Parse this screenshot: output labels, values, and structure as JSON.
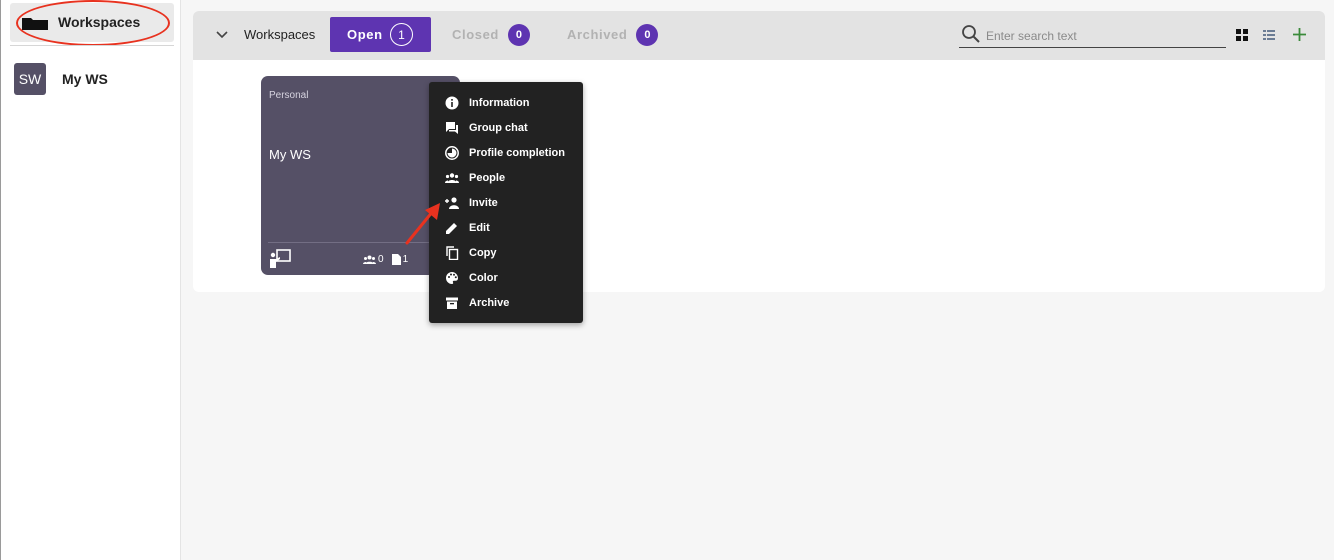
{
  "sidebar": {
    "header_title": "Workspaces",
    "items": [
      {
        "avatar": "SW",
        "label": "My WS"
      }
    ]
  },
  "toolbar": {
    "title": "Workspaces",
    "tabs": [
      {
        "label": "Open",
        "count": "1"
      },
      {
        "label": "Closed",
        "count": "0"
      },
      {
        "label": "Archived",
        "count": "0"
      }
    ],
    "search_placeholder": "Enter search text",
    "icons": [
      "chevron-down-icon",
      "search-icon",
      "grid-view-icon",
      "list-view-icon",
      "plus-icon"
    ]
  },
  "card": {
    "type": "Personal",
    "name": "My WS",
    "stats": {
      "people": "0",
      "documents": "1"
    }
  },
  "context_menu": {
    "items": [
      {
        "label": "Information",
        "icon": "info-icon"
      },
      {
        "label": "Group chat",
        "icon": "chat-icon"
      },
      {
        "label": "Profile completion",
        "icon": "pie-chart-icon"
      },
      {
        "label": "People",
        "icon": "people-icon"
      },
      {
        "label": "Invite",
        "icon": "person-add-icon"
      },
      {
        "label": "Edit",
        "icon": "pencil-icon"
      },
      {
        "label": "Copy",
        "icon": "copy-icon"
      },
      {
        "label": "Color",
        "icon": "palette-icon"
      },
      {
        "label": "Archive",
        "icon": "archive-icon"
      }
    ]
  },
  "colors": {
    "accent": "#5e34b1",
    "card": "#555066",
    "menu": "#222222",
    "annotation": "#e8321f",
    "add": "#3a8a3a"
  }
}
